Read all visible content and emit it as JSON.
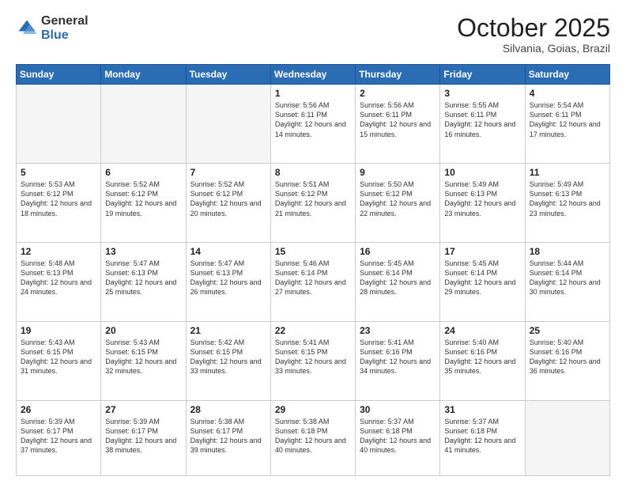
{
  "logo": {
    "general": "General",
    "blue": "Blue"
  },
  "title": "October 2025",
  "subtitle": "Silvania, Goias, Brazil",
  "days_of_week": [
    "Sunday",
    "Monday",
    "Tuesday",
    "Wednesday",
    "Thursday",
    "Friday",
    "Saturday"
  ],
  "weeks": [
    [
      {
        "day": "",
        "info": ""
      },
      {
        "day": "",
        "info": ""
      },
      {
        "day": "",
        "info": ""
      },
      {
        "day": "1",
        "info": "Sunrise: 5:56 AM\nSunset: 6:11 PM\nDaylight: 12 hours\nand 14 minutes."
      },
      {
        "day": "2",
        "info": "Sunrise: 5:56 AM\nSunset: 6:11 PM\nDaylight: 12 hours\nand 15 minutes."
      },
      {
        "day": "3",
        "info": "Sunrise: 5:55 AM\nSunset: 6:11 PM\nDaylight: 12 hours\nand 16 minutes."
      },
      {
        "day": "4",
        "info": "Sunrise: 5:54 AM\nSunset: 6:11 PM\nDaylight: 12 hours\nand 17 minutes."
      }
    ],
    [
      {
        "day": "5",
        "info": "Sunrise: 5:53 AM\nSunset: 6:12 PM\nDaylight: 12 hours\nand 18 minutes."
      },
      {
        "day": "6",
        "info": "Sunrise: 5:52 AM\nSunset: 6:12 PM\nDaylight: 12 hours\nand 19 minutes."
      },
      {
        "day": "7",
        "info": "Sunrise: 5:52 AM\nSunset: 6:12 PM\nDaylight: 12 hours\nand 20 minutes."
      },
      {
        "day": "8",
        "info": "Sunrise: 5:51 AM\nSunset: 6:12 PM\nDaylight: 12 hours\nand 21 minutes."
      },
      {
        "day": "9",
        "info": "Sunrise: 5:50 AM\nSunset: 6:12 PM\nDaylight: 12 hours\nand 22 minutes."
      },
      {
        "day": "10",
        "info": "Sunrise: 5:49 AM\nSunset: 6:13 PM\nDaylight: 12 hours\nand 23 minutes."
      },
      {
        "day": "11",
        "info": "Sunrise: 5:49 AM\nSunset: 6:13 PM\nDaylight: 12 hours\nand 23 minutes."
      }
    ],
    [
      {
        "day": "12",
        "info": "Sunrise: 5:48 AM\nSunset: 6:13 PM\nDaylight: 12 hours\nand 24 minutes."
      },
      {
        "day": "13",
        "info": "Sunrise: 5:47 AM\nSunset: 6:13 PM\nDaylight: 12 hours\nand 25 minutes."
      },
      {
        "day": "14",
        "info": "Sunrise: 5:47 AM\nSunset: 6:13 PM\nDaylight: 12 hours\nand 26 minutes."
      },
      {
        "day": "15",
        "info": "Sunrise: 5:46 AM\nSunset: 6:14 PM\nDaylight: 12 hours\nand 27 minutes."
      },
      {
        "day": "16",
        "info": "Sunrise: 5:45 AM\nSunset: 6:14 PM\nDaylight: 12 hours\nand 28 minutes."
      },
      {
        "day": "17",
        "info": "Sunrise: 5:45 AM\nSunset: 6:14 PM\nDaylight: 12 hours\nand 29 minutes."
      },
      {
        "day": "18",
        "info": "Sunrise: 5:44 AM\nSunset: 6:14 PM\nDaylight: 12 hours\nand 30 minutes."
      }
    ],
    [
      {
        "day": "19",
        "info": "Sunrise: 5:43 AM\nSunset: 6:15 PM\nDaylight: 12 hours\nand 31 minutes."
      },
      {
        "day": "20",
        "info": "Sunrise: 5:43 AM\nSunset: 6:15 PM\nDaylight: 12 hours\nand 32 minutes."
      },
      {
        "day": "21",
        "info": "Sunrise: 5:42 AM\nSunset: 6:15 PM\nDaylight: 12 hours\nand 33 minutes."
      },
      {
        "day": "22",
        "info": "Sunrise: 5:41 AM\nSunset: 6:15 PM\nDaylight: 12 hours\nand 33 minutes."
      },
      {
        "day": "23",
        "info": "Sunrise: 5:41 AM\nSunset: 6:16 PM\nDaylight: 12 hours\nand 34 minutes."
      },
      {
        "day": "24",
        "info": "Sunrise: 5:40 AM\nSunset: 6:16 PM\nDaylight: 12 hours\nand 35 minutes."
      },
      {
        "day": "25",
        "info": "Sunrise: 5:40 AM\nSunset: 6:16 PM\nDaylight: 12 hours\nand 36 minutes."
      }
    ],
    [
      {
        "day": "26",
        "info": "Sunrise: 5:39 AM\nSunset: 6:17 PM\nDaylight: 12 hours\nand 37 minutes."
      },
      {
        "day": "27",
        "info": "Sunrise: 5:39 AM\nSunset: 6:17 PM\nDaylight: 12 hours\nand 38 minutes."
      },
      {
        "day": "28",
        "info": "Sunrise: 5:38 AM\nSunset: 6:17 PM\nDaylight: 12 hours\nand 39 minutes."
      },
      {
        "day": "29",
        "info": "Sunrise: 5:38 AM\nSunset: 6:18 PM\nDaylight: 12 hours\nand 40 minutes."
      },
      {
        "day": "30",
        "info": "Sunrise: 5:37 AM\nSunset: 6:18 PM\nDaylight: 12 hours\nand 40 minutes."
      },
      {
        "day": "31",
        "info": "Sunrise: 5:37 AM\nSunset: 6:18 PM\nDaylight: 12 hours\nand 41 minutes."
      },
      {
        "day": "",
        "info": ""
      }
    ]
  ]
}
